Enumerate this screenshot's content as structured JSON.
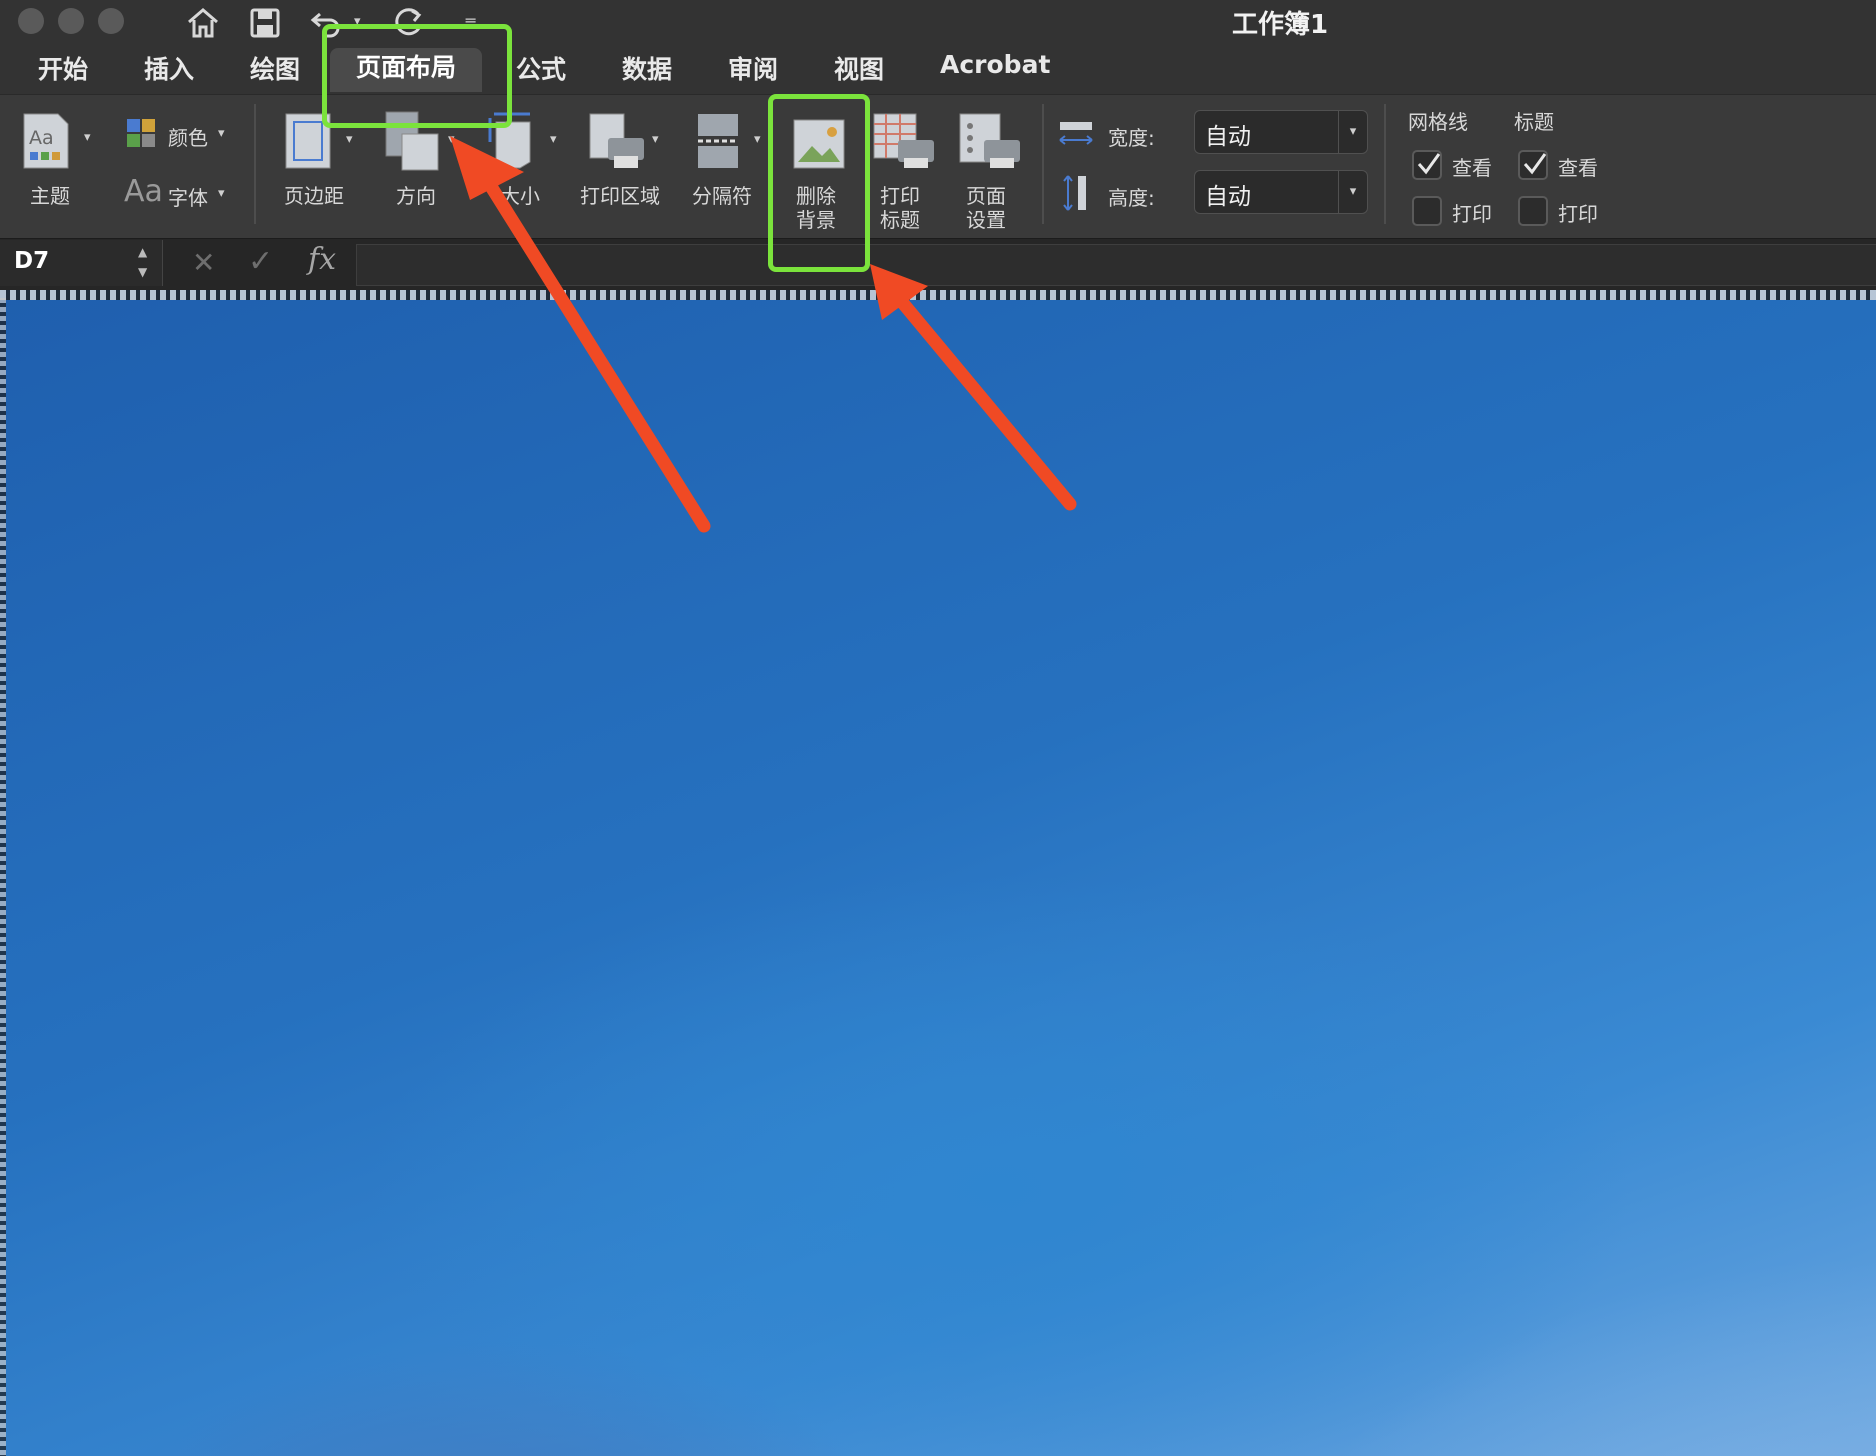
{
  "window": {
    "title": "工作簿1"
  },
  "tabs": [
    {
      "label": "开始"
    },
    {
      "label": "插入"
    },
    {
      "label": "绘图"
    },
    {
      "label": "页面布局"
    },
    {
      "label": "公式"
    },
    {
      "label": "数据"
    },
    {
      "label": "审阅"
    },
    {
      "label": "视图"
    },
    {
      "label": "Acrobat"
    }
  ],
  "ribbon": {
    "theme_label": "主题",
    "colors_label": "颜色",
    "fonts_label": "字体",
    "fonts_icon_text": "Aa",
    "margins_label": "页边距",
    "orientation_label": "方向",
    "size_label": "大小",
    "print_area_label": "打印区域",
    "breaks_label": "分隔符",
    "delete_background_line1": "删除",
    "delete_background_line2": "背景",
    "print_titles_line1": "打印",
    "print_titles_line2": "标题",
    "page_setup_line1": "页面",
    "page_setup_line2": "设置",
    "width_label": "宽度:",
    "width_value": "自动",
    "height_label": "高度:",
    "height_value": "自动",
    "gridlines_header": "网格线",
    "headings_header": "标题",
    "gridlines_view_label": "查看",
    "gridlines_print_label": "打印",
    "headings_view_label": "查看",
    "headings_print_label": "打印",
    "gridlines_view_checked": true,
    "gridlines_print_checked": false,
    "headings_view_checked": true,
    "headings_print_checked": false
  },
  "formula_bar": {
    "name_box": "D7",
    "fx_label": "fx",
    "formula": ""
  },
  "annotations": {
    "highlight_color": "#7be33c",
    "arrow_color": "#f04a24"
  }
}
